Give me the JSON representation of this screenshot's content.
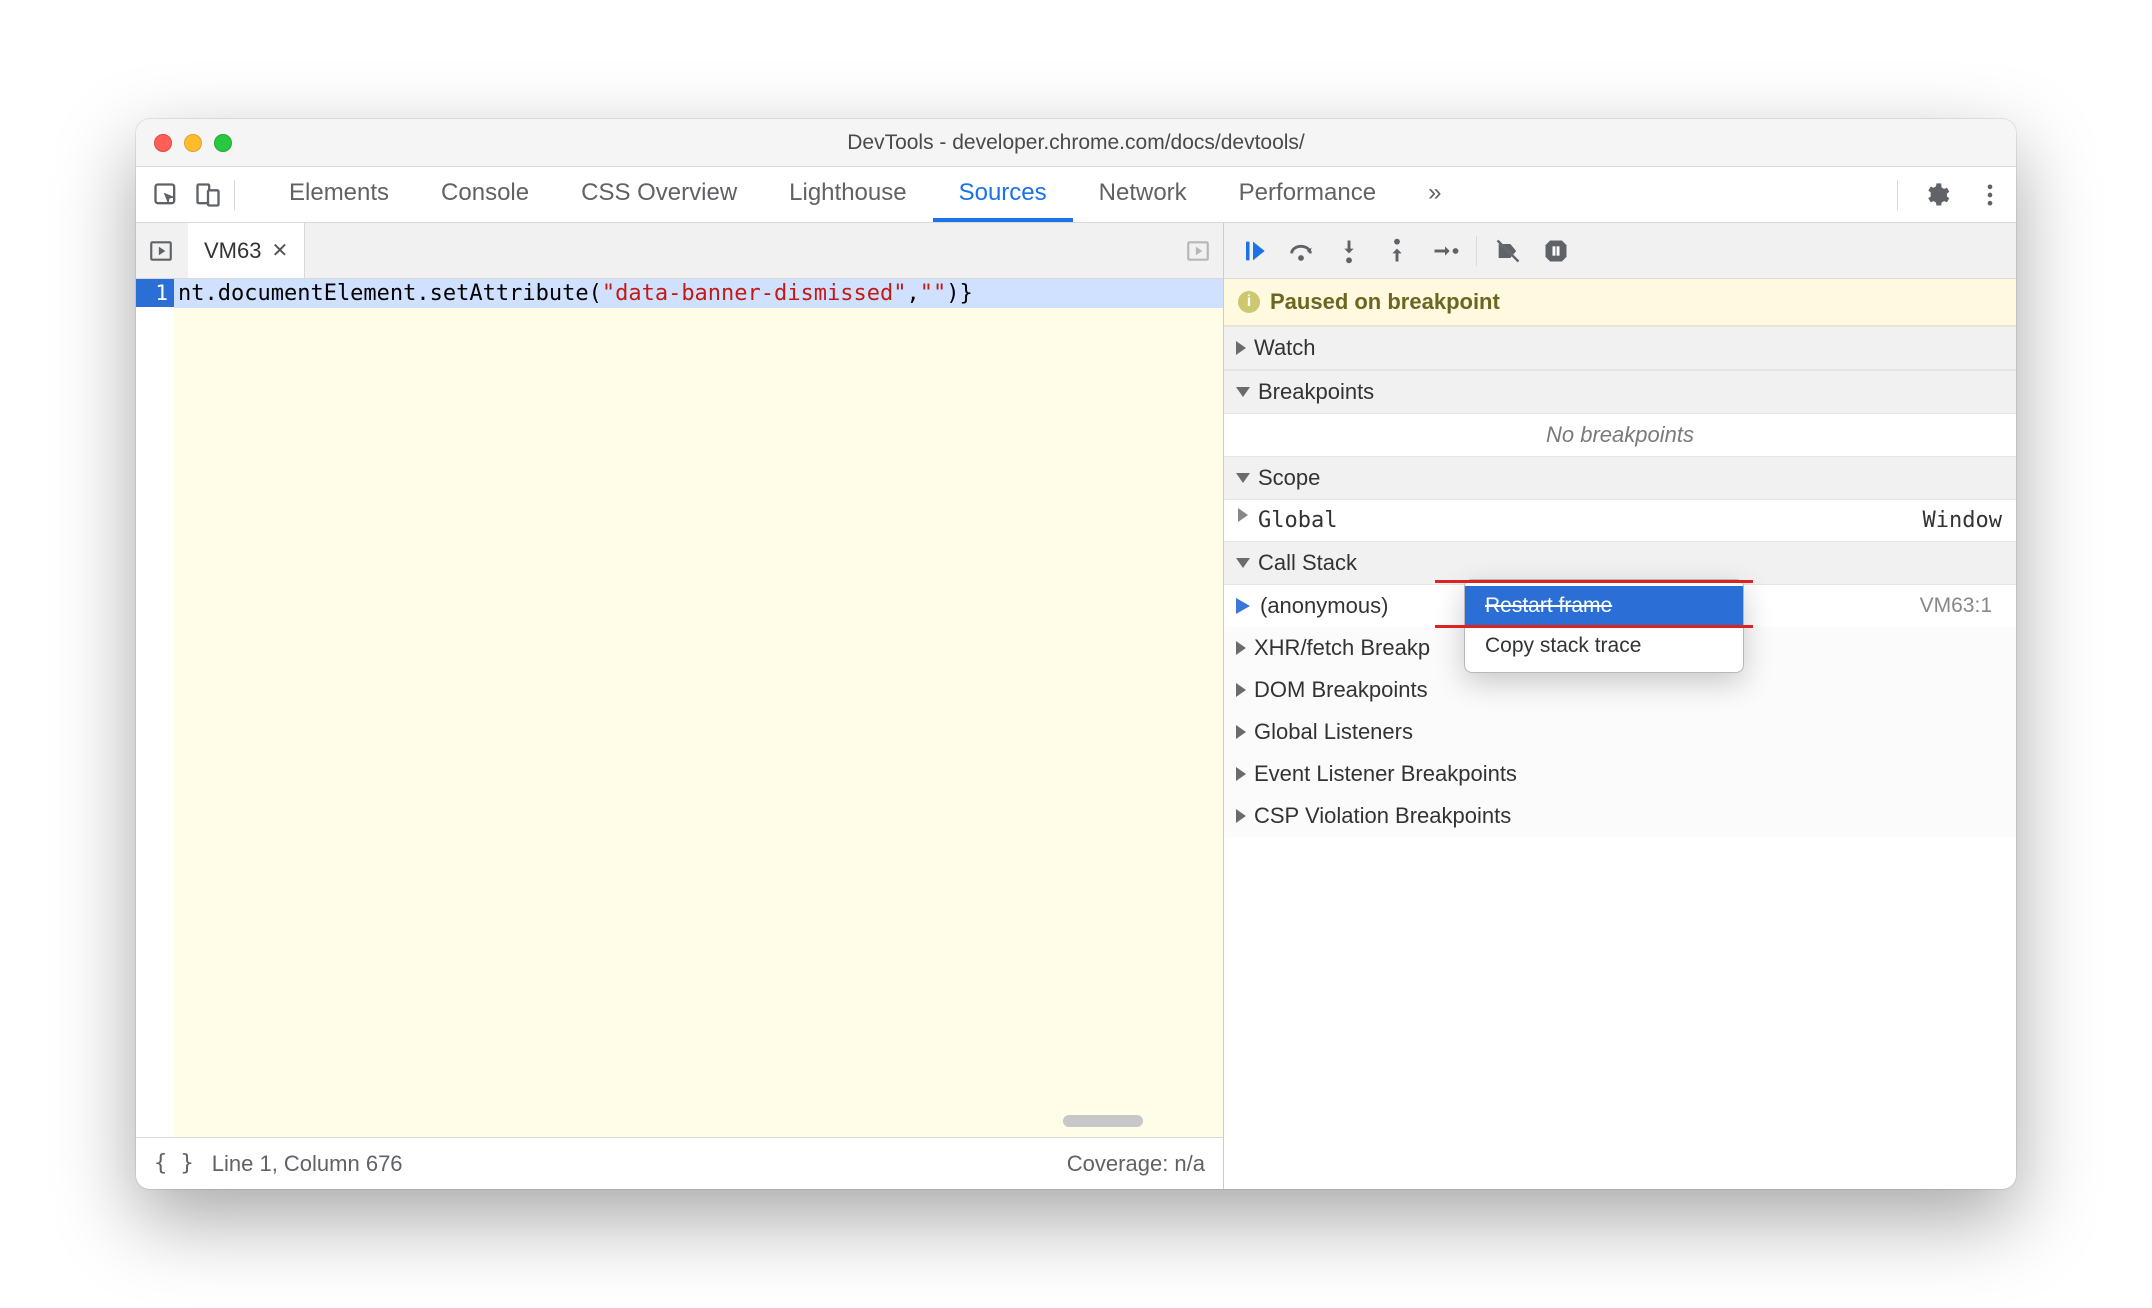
{
  "window": {
    "title": "DevTools - developer.chrome.com/docs/devtools/"
  },
  "toolbar": {
    "tabs": [
      "Elements",
      "Console",
      "CSS Overview",
      "Lighthouse",
      "Sources",
      "Network",
      "Performance"
    ],
    "active_tab_index": 4,
    "overflow_glyph": "»"
  },
  "editor": {
    "file_tab": "VM63",
    "line_number": "1",
    "code_prefix": "nt.documentElement.setAttribute(",
    "code_string": "\"data-banner-dismissed\"",
    "code_mid": ",",
    "code_string2": "\"\"",
    "code_suffix": ")}",
    "status_left": "Line 1, Column 676",
    "status_right": "Coverage: n/a",
    "braces": "{ }"
  },
  "debugger": {
    "pause_banner": "Paused on breakpoint",
    "sections": {
      "watch": "Watch",
      "breakpoints": "Breakpoints",
      "no_breakpoints": "No breakpoints",
      "scope": "Scope",
      "scope_global_label": "Global",
      "scope_global_value": "Window",
      "callstack": "Call Stack",
      "callstack_item": "(anonymous)",
      "callstack_location": "VM63:1",
      "xhr": "XHR/fetch Breakp",
      "dom": "DOM Breakpoints",
      "global_listeners": "Global Listeners",
      "event_listeners": "Event Listener Breakpoints",
      "csp": "CSP Violation Breakpoints"
    },
    "context_menu": {
      "items": [
        "Restart frame",
        "Copy stack trace"
      ],
      "highlighted_index": 0
    }
  }
}
